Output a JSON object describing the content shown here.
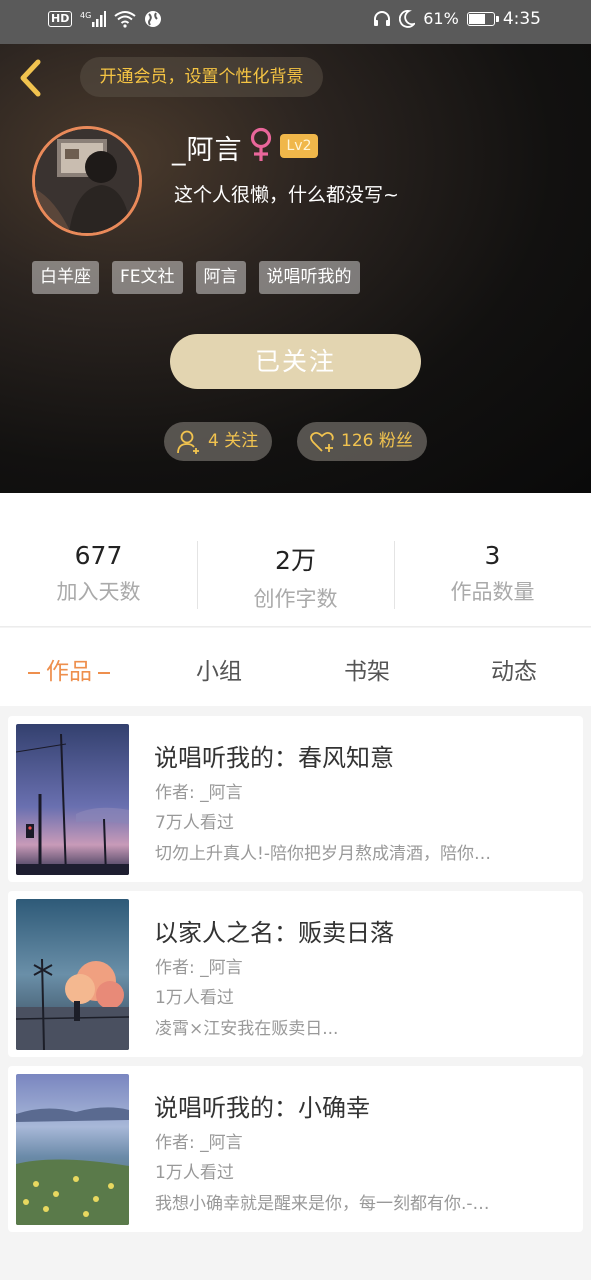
{
  "status_bar": {
    "hd": "HD",
    "network": "4G",
    "battery_percent": "61%",
    "battery_level": 0.61,
    "time": "4:35",
    "icons": [
      "hd-icon",
      "signal-icon",
      "wifi-icon",
      "globe-icon",
      "headphones-icon",
      "moon-icon",
      "battery-icon"
    ]
  },
  "header": {
    "vip_banner": "开通会员，设置个性化背景",
    "username": "_阿言",
    "level": "Lv2",
    "bio": "这个人很懒，什么都没写~",
    "tags": [
      "白羊座",
      "FE文社",
      "阿言",
      "说唱听我的"
    ],
    "follow_button": "已关注",
    "following_label": "4 关注",
    "fans_label": "126 粉丝",
    "accent_color": "#f1c34f",
    "gender_color": "#e9669a"
  },
  "stats": [
    {
      "value": "677",
      "label": "加入天数"
    },
    {
      "value": "2万",
      "label": "创作字数"
    },
    {
      "value": "3",
      "label": "作品数量"
    }
  ],
  "tabs": [
    {
      "label": "作品",
      "active": true
    },
    {
      "label": "小组",
      "active": false
    },
    {
      "label": "书架",
      "active": false
    },
    {
      "label": "动态",
      "active": false
    }
  ],
  "works": [
    {
      "title": "说唱听我的：春风知意",
      "author": "作者: _阿言",
      "views": "7万人看过",
      "desc": "切勿上升真人!-陪你把岁月熬成清酒，陪你…"
    },
    {
      "title": "以家人之名：贩卖日落",
      "author": "作者: _阿言",
      "views": "1万人看过",
      "desc": "凌霄×江安我在贩卖日..."
    },
    {
      "title": "说唱听我的：小确幸",
      "author": "作者: _阿言",
      "views": "1万人看过",
      "desc": "我想小确幸就是醒来是你，每一刻都有你.-…"
    }
  ]
}
